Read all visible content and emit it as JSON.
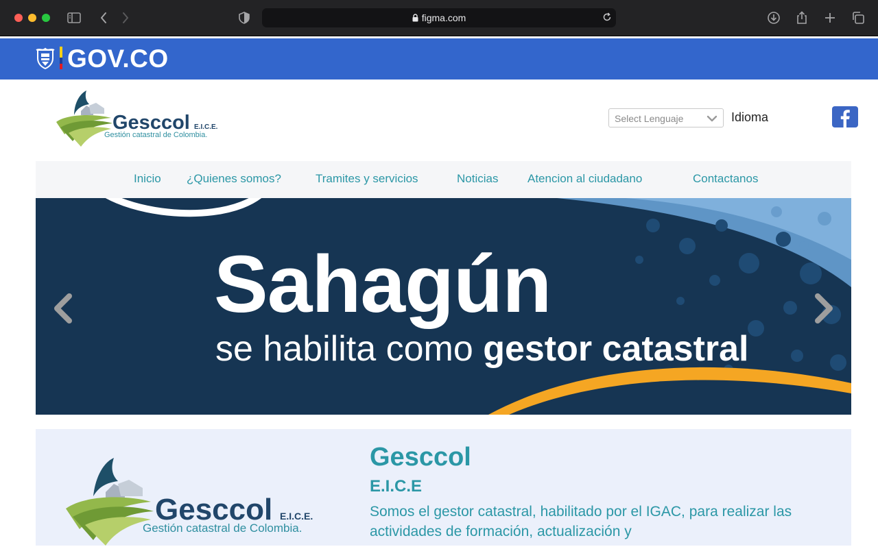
{
  "browser": {
    "url": "figma.com",
    "icons": [
      "sidebar-icon",
      "back-icon",
      "forward-icon",
      "shield-icon",
      "lock-icon",
      "reload-icon",
      "download-icon",
      "share-icon",
      "plus-icon",
      "tabs-icon"
    ]
  },
  "govbar": {
    "label": "GOV.CO",
    "color": "#3366cc"
  },
  "header": {
    "logo_brand": "Gesccol",
    "logo_suffix": "E.I.C.E.",
    "logo_tagline": "Gestión catastral de Colombia.",
    "language_select_placeholder": "Select Lenguaje",
    "language_label": "Idioma",
    "social_icon": "facebook-icon"
  },
  "nav": {
    "items": [
      {
        "label": "Inicio"
      },
      {
        "label": "¿Quienes somos?"
      },
      {
        "label": "Tramites y servicios"
      },
      {
        "label": "Noticias"
      },
      {
        "label": "Atencion al ciudadano"
      },
      {
        "label": "Contactanos"
      }
    ]
  },
  "hero": {
    "title": "Sahagún",
    "subtitle_regular": "se habilita como ",
    "subtitle_bold": "gestor catastral",
    "prev_icon": "chevron-left-icon",
    "next_icon": "chevron-right-icon"
  },
  "about": {
    "title": "Gesccol",
    "subtitle": "E.I.C.E",
    "text": "Somos el gestor catastral, habilitado por el IGAC, para realizar las actividades de formación, actualización y",
    "logo_brand": "Gesccol",
    "logo_suffix": "E.I.C.E.",
    "logo_tagline": "Gestión catastral de Colombia."
  },
  "colors": {
    "accent": "#2b97a6",
    "hero_bg": "#163553",
    "about_bg": "#ebf0fb"
  }
}
